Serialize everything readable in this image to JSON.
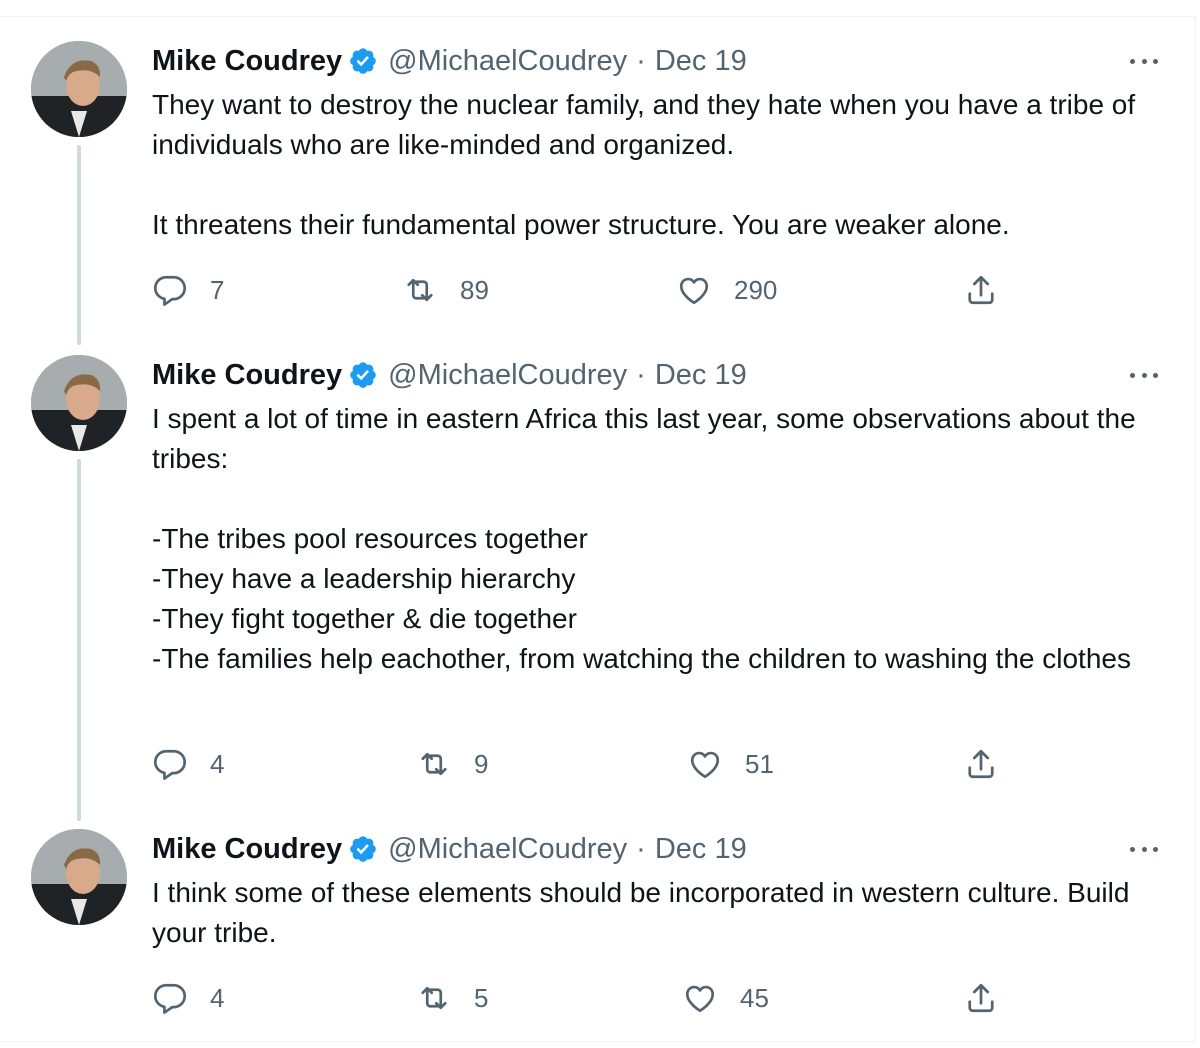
{
  "tweets": [
    {
      "name": "Mike Coudrey",
      "handle": "@MichaelCoudrey",
      "separator": "·",
      "date": "Dec 19",
      "paragraphs": [
        "They want to destroy the nuclear family, and they hate when you have a tribe of individuals who are like-minded and organized.",
        "It threatens their fundamental power structure. You are weaker alone."
      ],
      "replies": "7",
      "retweets": "89",
      "likes": "290"
    },
    {
      "name": "Mike Coudrey",
      "handle": "@MichaelCoudrey",
      "separator": "·",
      "date": "Dec 19",
      "paragraphs": [
        "I spent a lot of time in eastern Africa this last year, some observations about the tribes:",
        "-The tribes pool resources together",
        "-They have a leadership hierarchy",
        "-They fight together & die together",
        "-The families help eachother, from watching the children to washing the clothes"
      ],
      "replies": "4",
      "retweets": "9",
      "likes": "51"
    },
    {
      "name": "Mike Coudrey",
      "handle": "@MichaelCoudrey",
      "separator": "·",
      "date": "Dec 19",
      "paragraphs": [
        "I think some of these elements should be incorporated in western culture. Build your tribe."
      ],
      "replies": "4",
      "retweets": "5",
      "likes": "45"
    }
  ],
  "colors": {
    "verified": "#1d9bf0",
    "secondary_text": "#536471",
    "thread_line": "#cfd9de"
  },
  "icons": {
    "reply": "reply-icon",
    "retweet": "retweet-icon",
    "like": "heart-icon",
    "share": "share-icon",
    "more": "more-options-icon",
    "verified": "verified-badge-icon"
  }
}
